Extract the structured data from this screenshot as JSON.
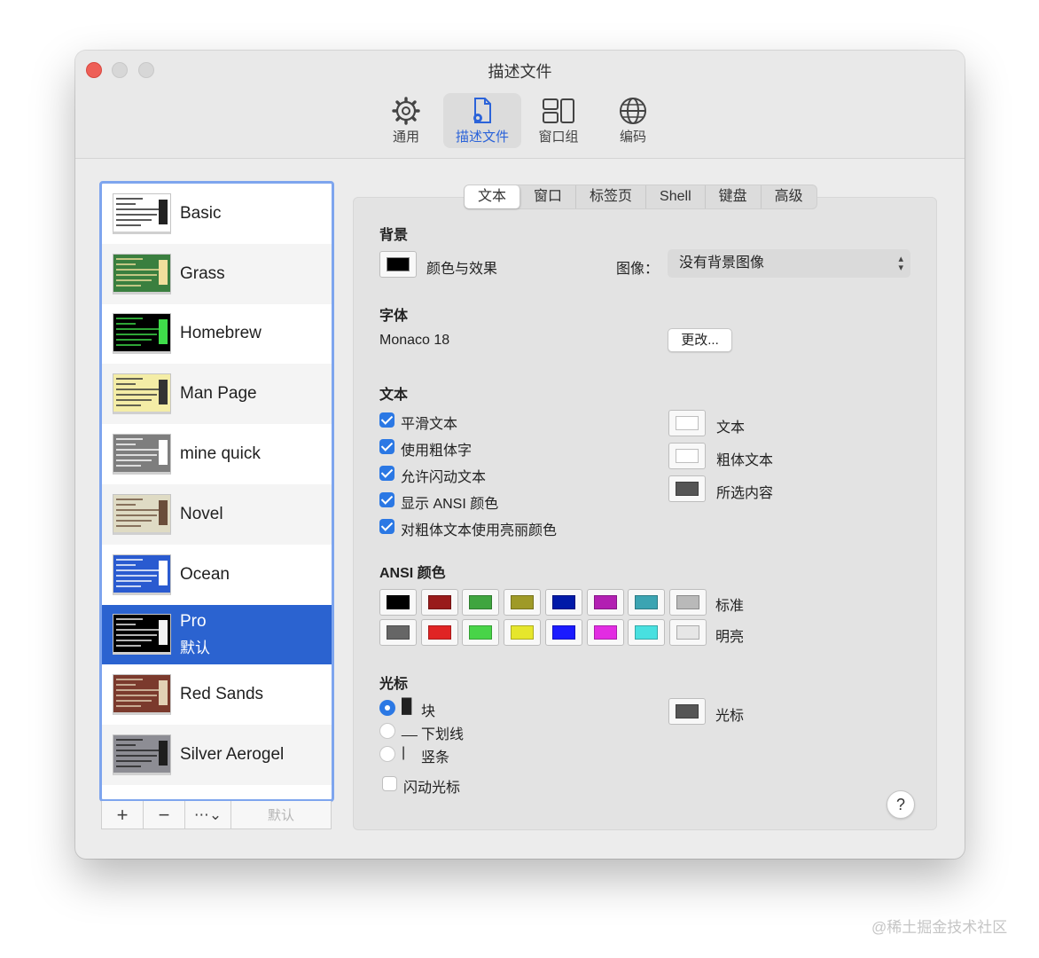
{
  "window": {
    "title": "描述文件"
  },
  "toolbar": {
    "general": "通用",
    "profiles": "描述文件",
    "window_groups": "窗口组",
    "encoding": "编码"
  },
  "profiles": [
    {
      "name": "Basic",
      "colors": [
        "#ffffff",
        "#222222"
      ]
    },
    {
      "name": "Grass",
      "colors": [
        "#3a7f3f",
        "#f1df9c"
      ]
    },
    {
      "name": "Homebrew",
      "colors": [
        "#000000",
        "#3fdd4a"
      ]
    },
    {
      "name": "Man Page",
      "colors": [
        "#f4eda6",
        "#333333"
      ]
    },
    {
      "name": "mine quick",
      "colors": [
        "#7e7e7e",
        "#ffffff"
      ]
    },
    {
      "name": "Novel",
      "colors": [
        "#dfdbc4",
        "#6a4d3a"
      ]
    },
    {
      "name": "Ocean",
      "colors": [
        "#2a5bd0",
        "#ffffff"
      ]
    },
    {
      "name": "Pro",
      "subtitle": "默认",
      "colors": [
        "#000000",
        "#f2f2f2"
      ]
    },
    {
      "name": "Red Sands",
      "colors": [
        "#7b3a2d",
        "#e2d1b5"
      ]
    },
    {
      "name": "Silver Aerogel",
      "colors": [
        "#8d8d94",
        "#1f1f1f"
      ]
    }
  ],
  "list_bar": {
    "add": "+",
    "remove": "−",
    "more": "⋯⌄",
    "default": "默认"
  },
  "tabs": [
    "文本",
    "窗口",
    "标签页",
    "Shell",
    "键盘",
    "高级"
  ],
  "background": {
    "heading": "背景",
    "color_label": "颜色与效果",
    "image_label": "图像：",
    "image_value": "没有背景图像",
    "color": "#000000"
  },
  "font": {
    "heading": "字体",
    "value": "Monaco 18",
    "change": "更改..."
  },
  "text": {
    "heading": "文本",
    "options": [
      {
        "label": "平滑文本",
        "checked": true
      },
      {
        "label": "使用粗体字",
        "checked": true
      },
      {
        "label": "允许闪动文本",
        "checked": true
      },
      {
        "label": "显示 ANSI 颜色",
        "checked": true
      },
      {
        "label": "对粗体文本使用亮丽颜色",
        "checked": true
      }
    ],
    "colors": [
      {
        "label": "文本",
        "color": "#ffffff"
      },
      {
        "label": "粗体文本",
        "color": "#ffffff"
      },
      {
        "label": "所选内容",
        "color": "#555555"
      }
    ]
  },
  "ansi": {
    "heading": "ANSI 颜色",
    "normal_label": "标准",
    "bright_label": "明亮",
    "normal": [
      "#000000",
      "#991b1b",
      "#3fa53f",
      "#9f9a27",
      "#0019a8",
      "#b21fb2",
      "#3ba4b2",
      "#b9b9b9"
    ],
    "bright": [
      "#666666",
      "#e02424",
      "#48d448",
      "#e6e62c",
      "#1a1aff",
      "#e22ce2",
      "#48e0e0",
      "#e6e6e6"
    ]
  },
  "cursor": {
    "heading": "光标",
    "shapes": [
      {
        "glyph": "█",
        "label": "块",
        "selected": true
      },
      {
        "glyph": "__",
        "label": "下划线",
        "selected": false
      },
      {
        "glyph": "|",
        "label": "竖条",
        "selected": false
      }
    ],
    "blink_label": "闪动光标",
    "color_label": "光标",
    "color": "#555555"
  },
  "help": "?",
  "watermark": "@稀土掘金技术社区"
}
